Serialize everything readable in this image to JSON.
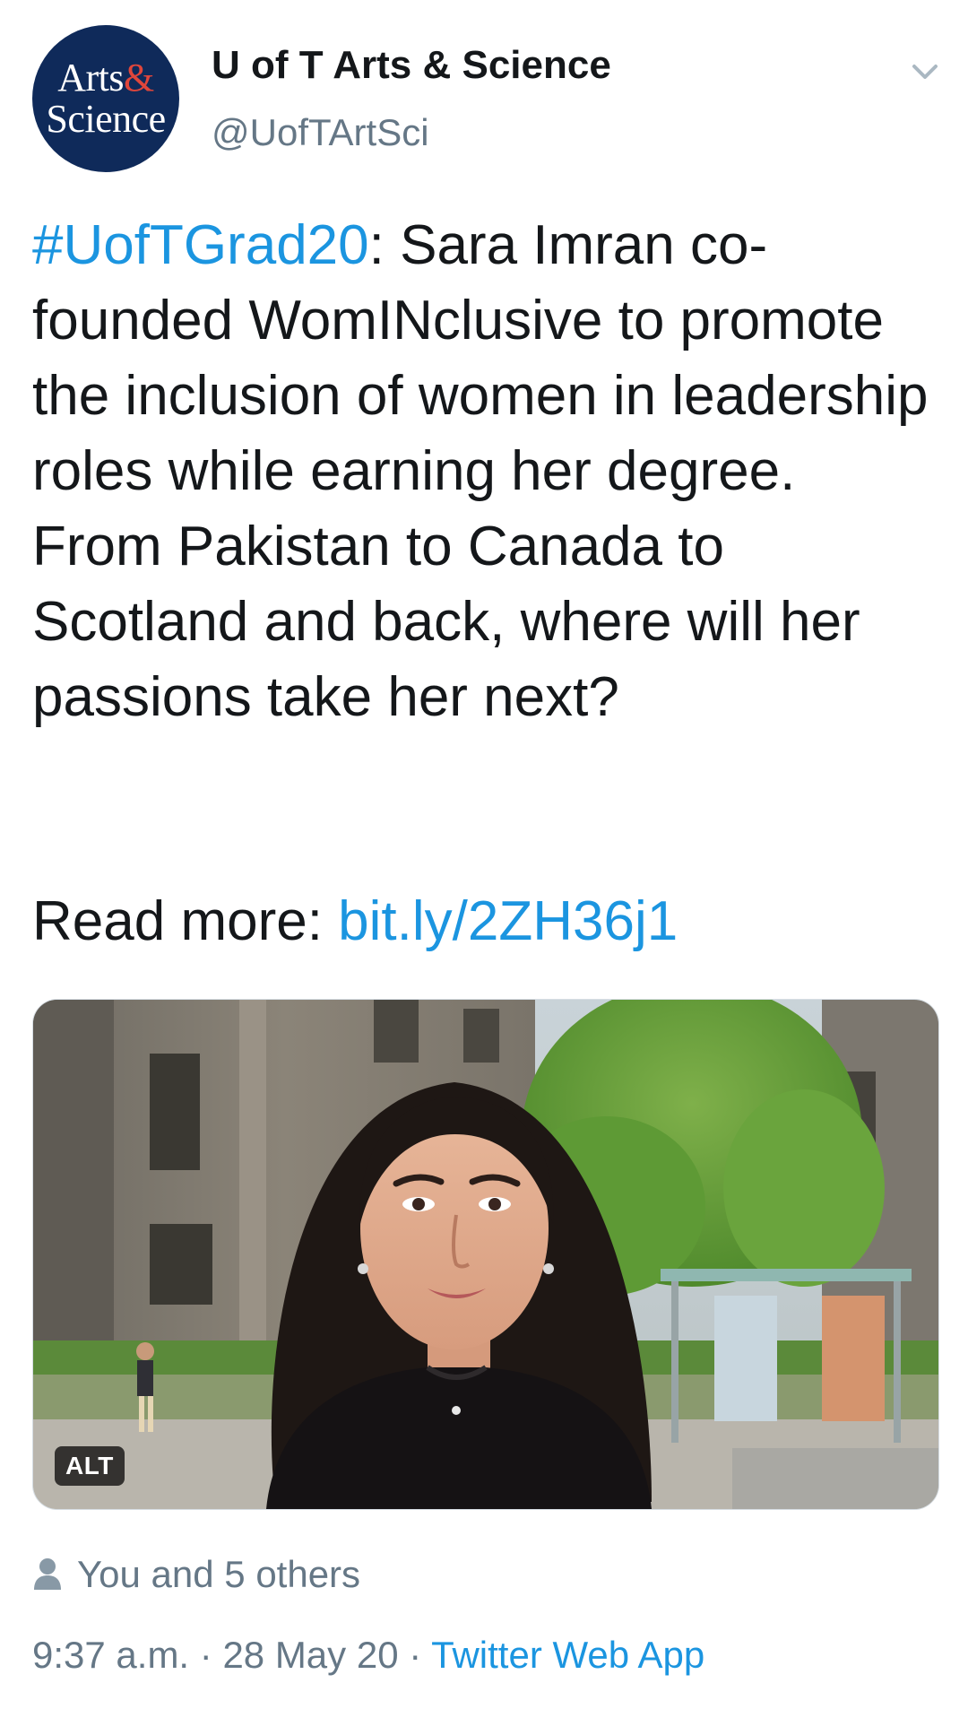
{
  "account": {
    "avatar_line1": "Arts",
    "avatar_amp": "&",
    "avatar_line2": "Science",
    "display_name": "U of T Arts & Science",
    "handle": "@UofTArtSci"
  },
  "tweet": {
    "hashtag": "#UofTGrad20",
    "text": ": Sara Imran co-founded WomINclusive to promote the inclusion of women in leadership roles while earning her degree. From Pakistan to Canada to Scotland and back, where will her passions take her next?",
    "readmore_label": "Read more: ",
    "link": "bit.ly/2ZH36j1"
  },
  "media": {
    "alt_badge": "ALT"
  },
  "footer": {
    "likes_text": "You and 5 others",
    "time": "9:37 a.m.",
    "sep1": " · ",
    "date": "28 May 20",
    "sep2": " · ",
    "app": "Twitter Web App"
  },
  "colors": {
    "link": "#1b95e0",
    "secondary_text": "#657786",
    "avatar_bg": "#0f2a5a"
  },
  "icons": [
    "chevron-down-icon",
    "person-icon"
  ]
}
